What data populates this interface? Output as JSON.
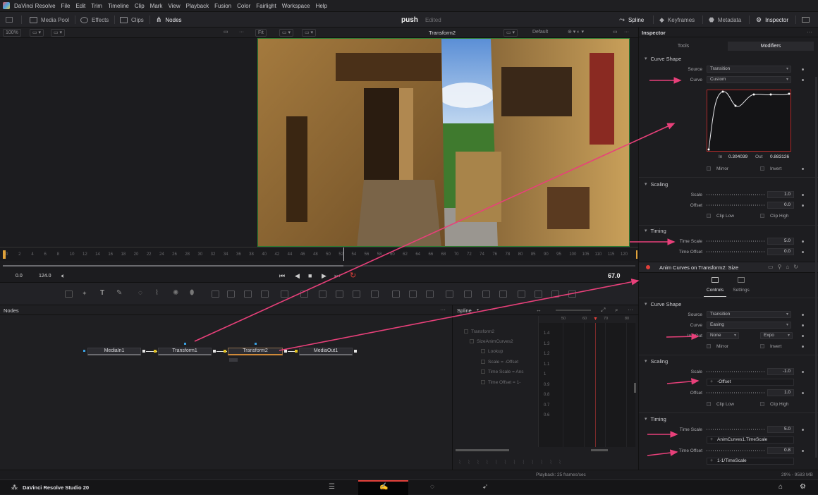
{
  "app": {
    "name": "DaVinci Resolve"
  },
  "menu": [
    "File",
    "Edit",
    "Trim",
    "Timeline",
    "Clip",
    "Mark",
    "View",
    "Playback",
    "Fusion",
    "Color",
    "Fairlight",
    "Workspace",
    "Help"
  ],
  "toolbar": {
    "media_pool": "Media Pool",
    "effects": "Effects",
    "clips": "Clips",
    "nodes": "Nodes",
    "project_title": "push",
    "project_status": "Edited",
    "spline": "Spline",
    "keyframes": "Keyframes",
    "metadata": "Metadata",
    "inspector": "Inspector"
  },
  "viewer": {
    "zoom": "100%",
    "fit": "Fit",
    "node_title": "Transform2",
    "lut": "Default"
  },
  "ruler": {
    "ticks": [
      "0",
      "2",
      "4",
      "6",
      "8",
      "10",
      "12",
      "14",
      "16",
      "18",
      "20",
      "22",
      "24",
      "26",
      "28",
      "30",
      "32",
      "34",
      "36",
      "38",
      "40",
      "42",
      "44",
      "46",
      "48",
      "50",
      "52",
      "54",
      "56",
      "58",
      "60",
      "62",
      "64",
      "66",
      "68",
      "70",
      "72",
      "74",
      "76",
      "78",
      "80",
      "85",
      "90",
      "95",
      "100",
      "105",
      "110",
      "115",
      "120"
    ]
  },
  "transport": {
    "start": "0.0",
    "end": "124.0",
    "current": "67.0"
  },
  "nodes": {
    "title": "Nodes",
    "items": {
      "media_in": "MediaIn1",
      "transform1": "Transform1",
      "transform2": "Transform2",
      "media_out": "MediaOut1"
    }
  },
  "spline": {
    "title": "Spline",
    "tree": [
      "Transform2",
      "SizeAnimCurves2",
      "Lookup",
      "Scale = -Offset",
      "Time Scale = Ans",
      "Time Offset = 1-"
    ],
    "y_ticks": [
      "1.4",
      "1.3",
      "1.2",
      "1.1",
      "1",
      "0.9",
      "0.8",
      "0.7",
      "0.6"
    ],
    "x_ticks": [
      "50",
      "60",
      "70",
      "80"
    ]
  },
  "status": {
    "playback": "Playback: 25 frames/sec",
    "memory": "29% - 9583 MB"
  },
  "pagebar": {
    "product": "DaVinci Resolve Studio 20"
  },
  "inspector": {
    "title": "Inspector",
    "tabs": {
      "tools": "Tools",
      "modifiers": "Modifiers"
    },
    "curve_shape_1": {
      "header": "Curve Shape",
      "source_label": "Source",
      "source_value": "Transition",
      "curve_label": "Curve",
      "curve_value": "Custom",
      "in_label": "In",
      "in_value": "0.304039",
      "out_label": "Out",
      "out_value": "0.883126",
      "mirror": "Mirror",
      "invert": "Invert"
    },
    "scaling_1": {
      "header": "Scaling",
      "scale_label": "Scale",
      "scale_value": "1.0",
      "offset_label": "Offset",
      "offset_value": "0.0",
      "clip_low": "Clip Low",
      "clip_high": "Clip High"
    },
    "timing_1": {
      "header": "Timing",
      "time_scale_label": "Time Scale",
      "time_scale_value": "5.0",
      "time_offset_label": "Time Offset",
      "time_offset_value": "0.0"
    },
    "anim": {
      "title": "Anim Curves on Transform2: Size",
      "controls_tab": "Controls",
      "settings_tab": "Settings",
      "curve_shape": {
        "header": "Curve Shape",
        "source_label": "Source",
        "source_value": "Transition",
        "curve_label": "Curve",
        "curve_value": "Easing",
        "inout_label": "In / Out",
        "in_value": "None",
        "out_value": "Expo",
        "mirror": "Mirror",
        "invert": "Invert"
      },
      "scaling": {
        "header": "Scaling",
        "scale_label": "Scale",
        "scale_value": "-1.0",
        "scale_expr": "-Offset",
        "offset_label": "Offset",
        "offset_value": "1.0",
        "clip_low": "Clip Low",
        "clip_high": "Clip High"
      },
      "timing": {
        "header": "Timing",
        "time_scale_label": "Time Scale",
        "time_scale_value": "5.0",
        "time_scale_expr": "AnimCurves1.TimeScale",
        "time_offset_label": "Time Offset",
        "time_offset_value": "0.8",
        "time_offset_expr": "1-1/TimeScale"
      }
    }
  },
  "colors": {
    "annotation": "#e8407a",
    "accent_red": "#e0403a",
    "keyframe_orange": "#e8a23a"
  }
}
